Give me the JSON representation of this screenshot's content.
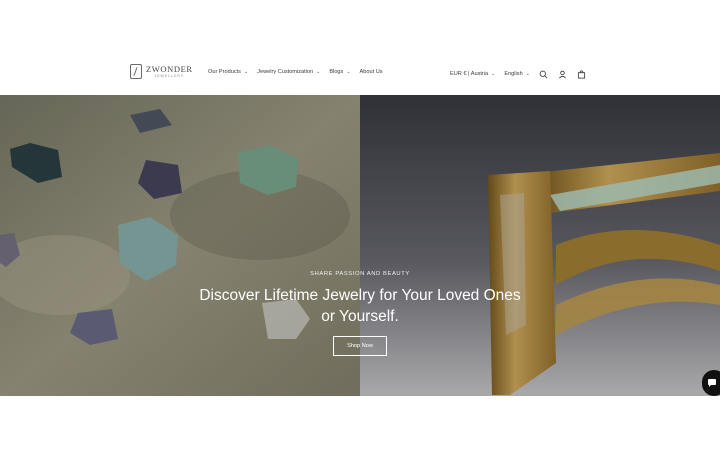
{
  "brand": {
    "name": "ZWONDER",
    "tagline": "JEWELLERY"
  },
  "nav": {
    "items": [
      {
        "label": "Our Products",
        "has_dropdown": true
      },
      {
        "label": "Jewelry Customization",
        "has_dropdown": true
      },
      {
        "label": "Blogs",
        "has_dropdown": true
      },
      {
        "label": "About Us",
        "has_dropdown": false
      }
    ]
  },
  "utils": {
    "currency": "EUR € | Austria",
    "language": "English",
    "icons": [
      "search-icon",
      "account-icon",
      "cart-icon"
    ]
  },
  "hero": {
    "eyebrow": "SHARE PASSION AND BEAUTY",
    "title_line1": "Discover Lifetime Jewelry for Your Loved Ones",
    "title_line2": "or Yourself.",
    "cta": "Shop Now"
  },
  "colors": {
    "background": "#ffffff",
    "text": "#2b2b2b",
    "hero_text": "#ffffff",
    "chat": "#111111"
  }
}
